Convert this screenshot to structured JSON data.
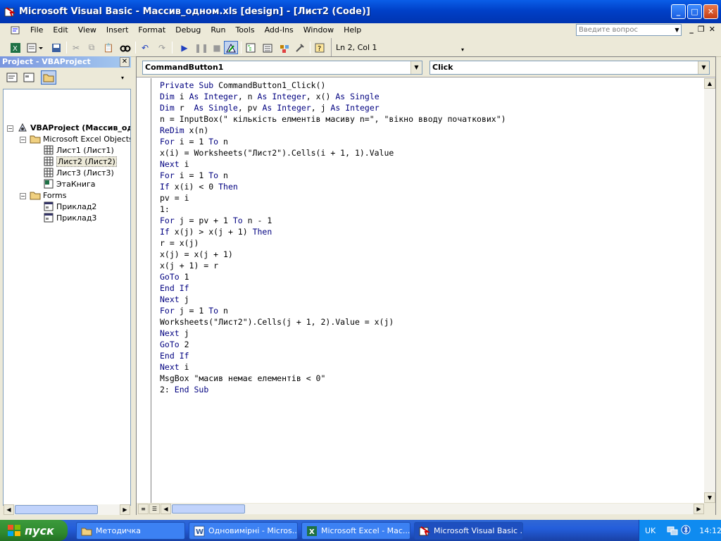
{
  "window": {
    "title": "Microsoft Visual Basic - Массив_одном.xls [design] - [Лист2 (Code)]"
  },
  "menu": {
    "items": [
      "File",
      "Edit",
      "View",
      "Insert",
      "Format",
      "Debug",
      "Run",
      "Tools",
      "Add-Ins",
      "Window",
      "Help"
    ],
    "help_placeholder": "Введите вопрос"
  },
  "toolbar": {
    "position": "Ln 2, Col 1"
  },
  "project": {
    "title": "Project - VBAProject",
    "root": "VBAProject (Массив_од",
    "excel_objects": "Microsoft Excel Objects",
    "sheets": [
      "Лист1 (Лист1)",
      "Лист2 (Лист2)",
      "Лист3 (Лист3)"
    ],
    "workbook": "ЭтаКнига",
    "forms_folder": "Forms",
    "forms": [
      "Приклад2",
      "Приклад3"
    ]
  },
  "code": {
    "object": "CommandButton1",
    "procedure": "Click",
    "lines": [
      "Private Sub CommandButton1_Click()",
      "Dim i As Integer, n As Integer, x() As Single",
      "Dim r  As Single, pv As Integer, j As Integer",
      "n = InputBox(\" кількість елментів масиву n=\", \"вікно вводу початкових\")",
      "ReDim x(n)",
      "For i = 1 To n",
      "x(i) = Worksheets(\"Лист2\").Cells(i + 1, 1).Value",
      "Next i",
      "For i = 1 To n",
      "If x(i) < 0 Then",
      "pv = i",
      "1:",
      "For j = pv + 1 To n - 1",
      "If x(j) > x(j + 1) Then",
      "r = x(j)",
      "x(j) = x(j + 1)",
      "x(j + 1) = r",
      "GoTo 1",
      "End If",
      "Next j",
      "For j = 1 To n",
      "Worksheets(\"Лист2\").Cells(j + 1, 2).Value = x(j)",
      "Next j",
      "GoTo 2",
      "End If",
      "Next i",
      "MsgBox \"масив немає елементів < 0\"",
      "2: End Sub"
    ]
  },
  "taskbar": {
    "start": "пуск",
    "tasks": [
      "Методичка",
      "Одновимірні - Micros...",
      "Microsoft Excel - Мас...",
      "Microsoft Visual Basic ..."
    ],
    "lang": "UK",
    "clock": "14:12"
  }
}
